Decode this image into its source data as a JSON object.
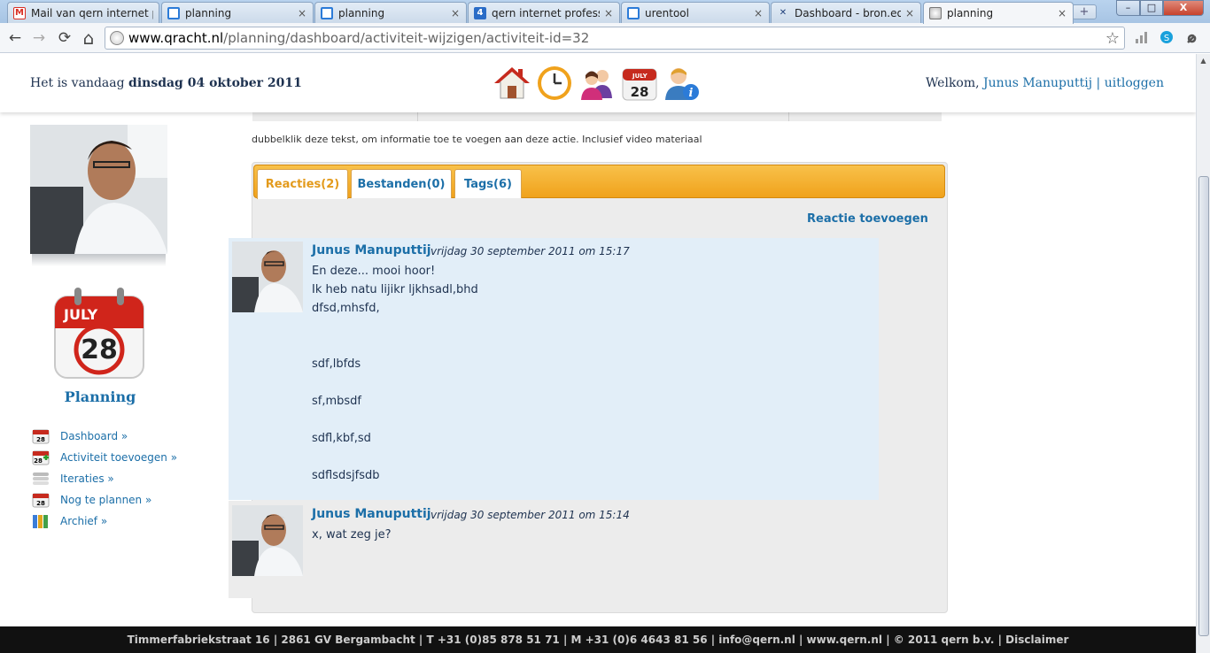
{
  "browser": {
    "tabs": [
      {
        "title": "Mail van qern internet p",
        "icon": "gmail-icon"
      },
      {
        "title": "planning",
        "icon": "planning-icon"
      },
      {
        "title": "planning",
        "icon": "planning-icon"
      },
      {
        "title": "qern internet profession",
        "icon": "four-icon",
        "icon_text": "4"
      },
      {
        "title": "urentool",
        "icon": "planning-icon"
      },
      {
        "title": "Dashboard - bron.eo.nl",
        "icon": "dashboard-icon"
      },
      {
        "title": "planning",
        "icon": "globe-icon",
        "active": true
      }
    ],
    "tab_close": "×",
    "new_tab": "+",
    "window_controls": {
      "minimize": "–",
      "maximize": "□",
      "close": "X"
    },
    "nav": {
      "back": "←",
      "forward": "→",
      "reload": "⟳",
      "home": "⌂"
    },
    "url_host": "www.qracht.nl",
    "url_path": "/planning/dashboard/activiteit-wijzigen/activiteit-id=32",
    "star": "☆",
    "wrench": "🔧"
  },
  "header": {
    "date_prefix": "Het is vandaag ",
    "date_value": "dinsdag 04 oktober 2011",
    "welcome_prefix": "Welkom, ",
    "user_name": "Junus Manuputtij",
    "separator": " | ",
    "logout": "uitloggen",
    "nav_icons": [
      "home-icon",
      "clock-icon",
      "users-icon",
      "calendar-icon",
      "user-info-icon"
    ],
    "calendar_month": "JULY",
    "calendar_day": "28"
  },
  "sidebar": {
    "title": "Planning",
    "calendar_month": "JULY",
    "calendar_day": "28",
    "items": [
      {
        "label": "Dashboard »",
        "icon": "calendar-icon"
      },
      {
        "label": "Activiteit toevoegen »",
        "icon": "calendar-add-icon"
      },
      {
        "label": "Iteraties »",
        "icon": "stack-icon"
      },
      {
        "label": "Nog te plannen »",
        "icon": "calendar-icon"
      },
      {
        "label": "Archief »",
        "icon": "archive-icon"
      }
    ]
  },
  "main": {
    "info_text": "dubbelklik deze tekst, om informatie toe te voegen aan deze actie. Inclusief video materiaal",
    "tabs": [
      {
        "label": "Reacties(2)",
        "active": true
      },
      {
        "label": "Bestanden(0)"
      },
      {
        "label": "Tags(6)"
      }
    ],
    "add_reaction": "Reactie toevoegen",
    "reactions": [
      {
        "author": "Junus Manuputtij",
        "date": "vrijdag 30 september 2011 om 15:17",
        "lines": [
          "En deze... mooi hoor!",
          "Ik heb natu lijikr ljkhsadl,bhd",
          "dfsd,mhsfd,",
          "",
          "",
          "sdf,lbfds",
          "",
          "sf,mbsdf",
          "",
          "sdfl,kbf,sd",
          "",
          "sdflsdsjfsdb"
        ]
      },
      {
        "author": "Junus Manuputtij",
        "date": "vrijdag 30 september 2011 om 15:14",
        "lines": [
          "x, wat zeg je?"
        ]
      }
    ]
  },
  "footer": {
    "text": "Timmerfabriekstraat 16 | 2861 GV Bergambacht | T +31 (0)85 878 51 71 | M +31 (0)6 4643 81 56 | info@qern.nl | www.qern.nl | © 2011 qern b.v. | Disclaimer"
  }
}
